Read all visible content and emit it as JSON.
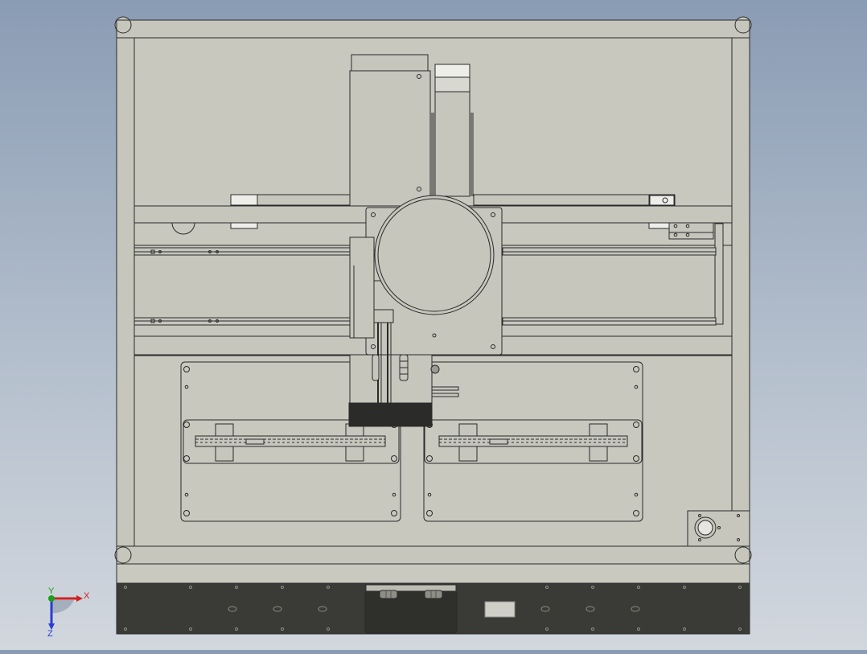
{
  "viewport": {
    "background_top": "#8a9cb4",
    "background_bottom": "#d2d7de"
  },
  "model": {
    "body_color": "#c6c6bd",
    "panel_color": "#c9c9c0",
    "line_color": "#2a2a2a",
    "dark_color": "#3a3a36",
    "head_block_color": "#2b2b29"
  },
  "triad": {
    "x_label": "X",
    "y_label": "Y",
    "z_label": "Z",
    "x_color": "#d12020",
    "y_color": "#1aa01a",
    "z_color": "#2b3bd6"
  }
}
